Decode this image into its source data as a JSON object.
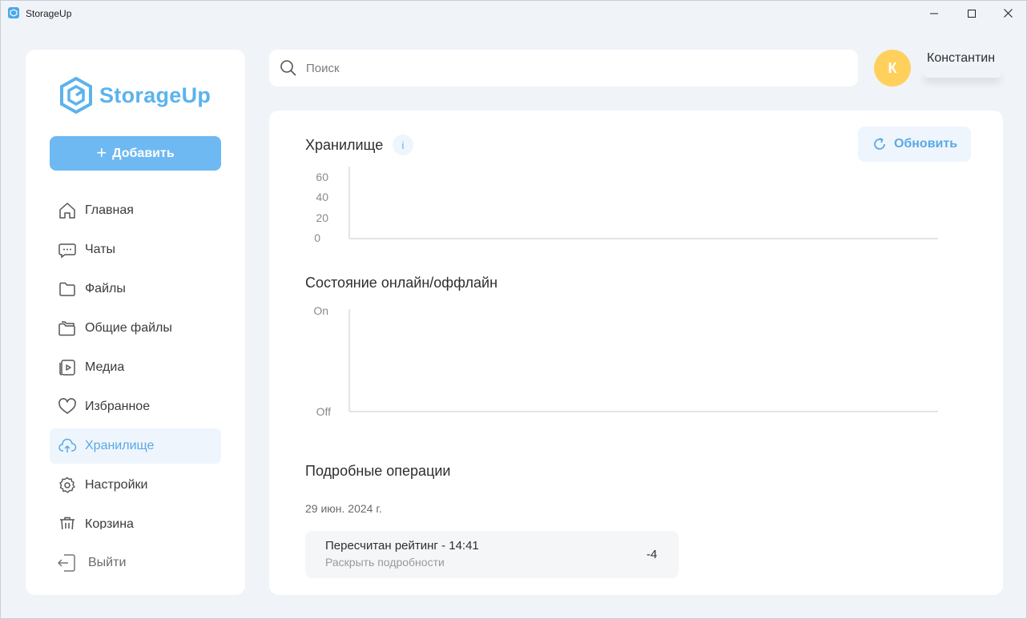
{
  "window": {
    "title": "StorageUp"
  },
  "sidebar": {
    "logo_text": "StorageUp",
    "add_button": {
      "icon": "plus-icon",
      "label": "Добавить"
    },
    "items": [
      {
        "icon": "home-icon",
        "label": "Главная",
        "active": false
      },
      {
        "icon": "chat-icon",
        "label": "Чаты",
        "active": false
      },
      {
        "icon": "folder-icon",
        "label": "Файлы",
        "active": false
      },
      {
        "icon": "shared-folder-icon",
        "label": "Общие файлы",
        "active": false
      },
      {
        "icon": "media-icon",
        "label": "Медиа",
        "active": false
      },
      {
        "icon": "heart-icon",
        "label": "Избранное",
        "active": false
      },
      {
        "icon": "cloud-upload-icon",
        "label": "Хранилище",
        "active": true
      },
      {
        "icon": "gear-icon",
        "label": "Настройки",
        "active": false
      },
      {
        "icon": "trash-icon",
        "label": "Корзина",
        "active": false
      }
    ],
    "logout": {
      "icon": "logout-icon",
      "label": "Выйти"
    }
  },
  "search": {
    "placeholder": "Поиск",
    "value": ""
  },
  "user": {
    "initial": "К",
    "name": "Константин"
  },
  "main": {
    "storage_title": "Хранилище",
    "info_label": "i",
    "refresh_button": "Обновить",
    "online_title": "Состояние онлайн/оффлайн",
    "operations_title": "Подробные операции",
    "date": "29 июн. 2024 г.",
    "operation": {
      "title": "Пересчитан рейтинг - 14:41",
      "subtitle": "Раскрыть подробности",
      "value": "-4"
    }
  },
  "colors": {
    "accent": "#5aa9e6",
    "button_primary": "#6eb9f2",
    "active_bg": "#eef5fd",
    "avatar_bg": "#ffd15c",
    "page_bg": "#f0f3f8"
  },
  "chart_data": [
    {
      "type": "line",
      "title": "Хранилище",
      "y_ticks": [
        "60",
        "40",
        "20",
        "0"
      ],
      "ylim": [
        0,
        60
      ],
      "series": [],
      "grid": false
    },
    {
      "type": "line",
      "title": "Состояние онлайн/оффлайн",
      "y_ticks": [
        "On",
        "Off"
      ],
      "series": [],
      "grid": false
    }
  ]
}
